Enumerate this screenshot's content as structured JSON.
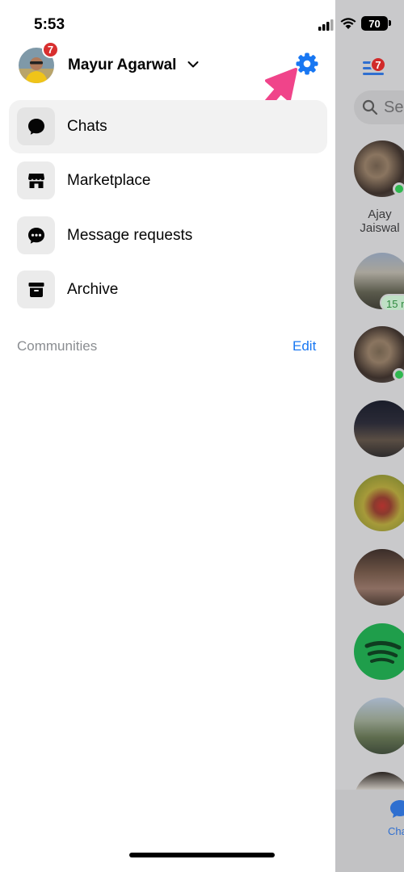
{
  "status_bar": {
    "time": "5:53",
    "battery": "70"
  },
  "profile": {
    "name": "Mayur Agarwal",
    "badge_count": "7"
  },
  "menu": {
    "items": [
      {
        "label": "Chats",
        "icon": "chat-bubble-icon",
        "active": true
      },
      {
        "label": "Marketplace",
        "icon": "storefront-icon",
        "active": false
      },
      {
        "label": "Message requests",
        "icon": "message-dots-icon",
        "active": false
      },
      {
        "label": "Archive",
        "icon": "archive-box-icon",
        "active": false
      }
    ]
  },
  "communities": {
    "title": "Communities",
    "edit_label": "Edit"
  },
  "background": {
    "badge_count": "7",
    "search_placeholder": "Se",
    "contact_name_line1": "Ajay",
    "contact_name_line2": "Jaiswal",
    "active_chip": "15 m",
    "tab_label": "Cha"
  },
  "colors": {
    "accent": "#1877f2",
    "badge": "#d82f2f",
    "arrow": "#f0448a",
    "online": "#2fb84f"
  }
}
